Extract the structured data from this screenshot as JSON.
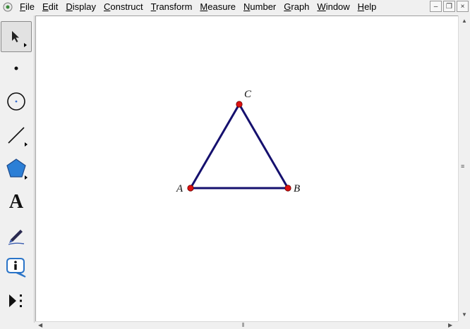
{
  "menu": {
    "items": [
      "File",
      "Edit",
      "Display",
      "Construct",
      "Transform",
      "Measure",
      "Number",
      "Graph",
      "Window",
      "Help"
    ]
  },
  "window_controls": {
    "minimize": "–",
    "restore": "❐",
    "close": "×"
  },
  "toolbox": {
    "tools": [
      {
        "name": "arrow-tool",
        "selected": true
      },
      {
        "name": "point-tool"
      },
      {
        "name": "compass-tool"
      },
      {
        "name": "straightedge-tool"
      },
      {
        "name": "polygon-tool"
      },
      {
        "name": "text-tool",
        "glyph": "A"
      },
      {
        "name": "marker-tool"
      },
      {
        "name": "information-tool"
      },
      {
        "name": "custom-tools"
      }
    ]
  },
  "sketch": {
    "points": [
      {
        "label": "A"
      },
      {
        "label": "B"
      },
      {
        "label": "C"
      }
    ],
    "segment_color": "#15106e",
    "point_color": "#dd1111"
  },
  "scrollbar": {
    "grip": "⦀"
  }
}
